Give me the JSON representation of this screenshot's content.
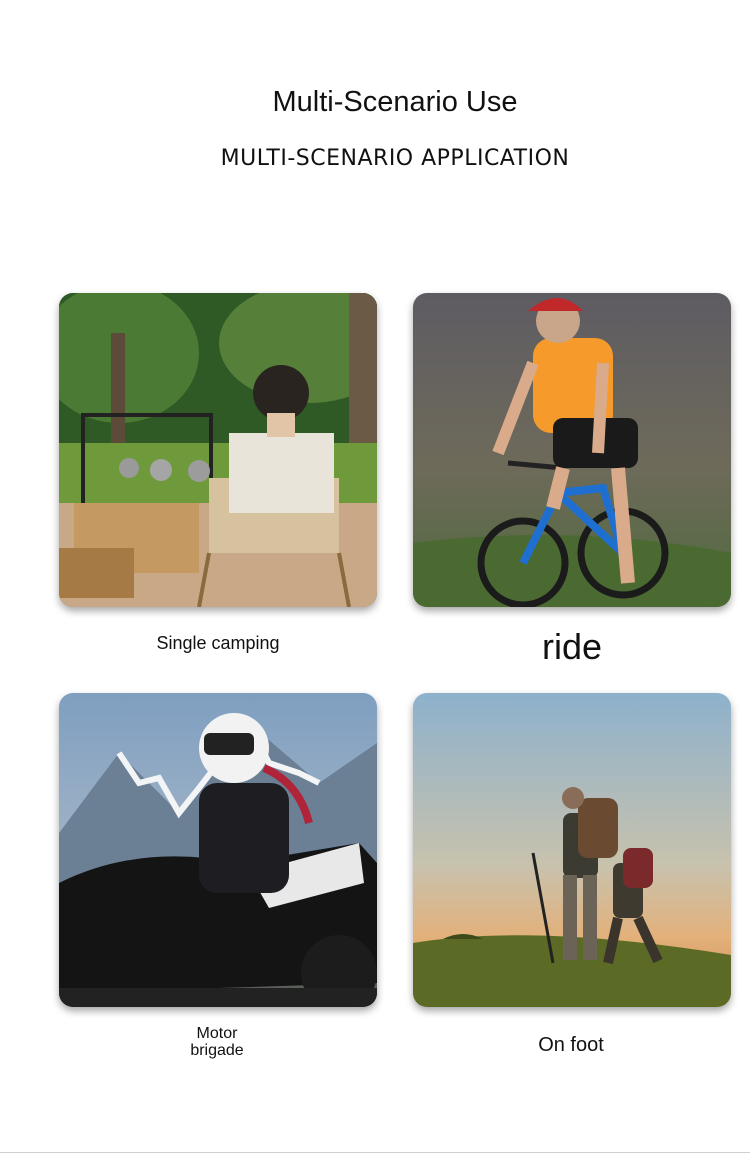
{
  "header": {
    "title": "Multi-Scenario Use",
    "subtitle": "MULTI-SCENARIO APPLICATION"
  },
  "scenarios": [
    {
      "caption": "Single camping",
      "image": "camping-photo"
    },
    {
      "caption": "ride",
      "image": "cycling-photo"
    },
    {
      "caption_line1": "Motor",
      "caption_line2": "brigade",
      "image": "motorcycle-photo"
    },
    {
      "caption": "On foot",
      "image": "hiking-photo"
    }
  ]
}
